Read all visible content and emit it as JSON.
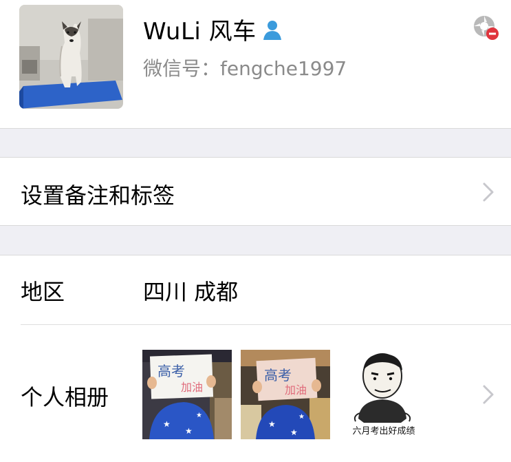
{
  "profile": {
    "name": "WuLi 风车",
    "wechat_id": "微信号：fengche1997",
    "gender_icon": "male-user-icon",
    "status_icon": "blocked-camera-icon"
  },
  "remark_row": {
    "label": "设置备注和标签"
  },
  "region_row": {
    "label": "地区",
    "value": "四川 成都"
  },
  "album_row": {
    "label": "个人相册",
    "photos": [
      {
        "kind": "sign-photo",
        "sign_line1": "高考",
        "sign_line2": "加油"
      },
      {
        "kind": "sign-photo",
        "sign_line1": "高考",
        "sign_line2": "加油"
      },
      {
        "kind": "meme",
        "caption": "六月考出好成绩"
      }
    ]
  },
  "colors": {
    "accent_blue": "#3b9bdc",
    "gray_text": "#8a8a8a",
    "background": "#efeff4",
    "badge_red": "#e0343d"
  }
}
